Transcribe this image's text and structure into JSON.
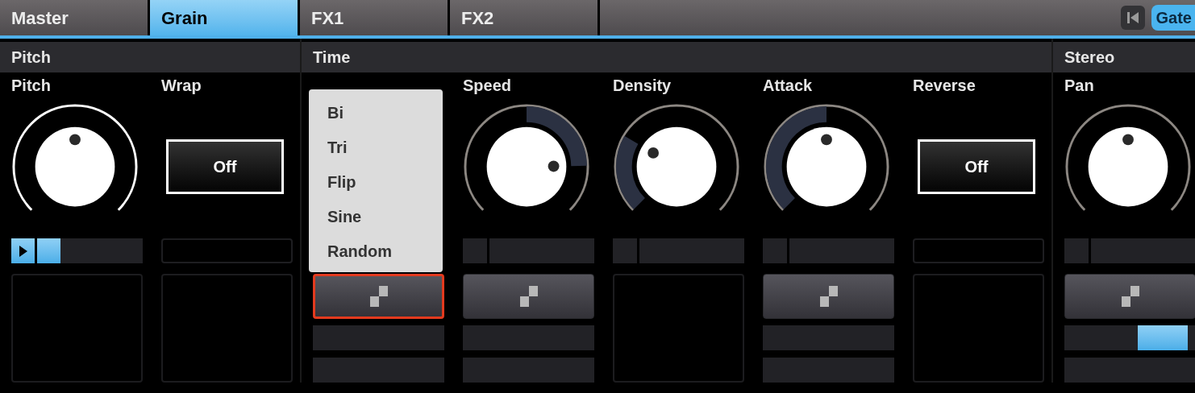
{
  "tabs": [
    {
      "label": "Master",
      "selected": false
    },
    {
      "label": "Grain",
      "selected": true
    },
    {
      "label": "FX1",
      "selected": false
    },
    {
      "label": "FX2",
      "selected": false
    }
  ],
  "gate": {
    "label": "Gate",
    "on": true
  },
  "sections": [
    {
      "title": "Pitch",
      "columns": [
        {
          "label": "Pitch",
          "control": {
            "kind": "knob",
            "highlighted": true
          },
          "slot": {
            "kind": "play",
            "level": 0.22
          },
          "lower": {
            "kind": "empty"
          }
        },
        {
          "label": "Wrap",
          "control": {
            "kind": "toggle",
            "label": "Off",
            "on": false
          },
          "slot": {
            "kind": "outline"
          },
          "lower": {
            "kind": "empty"
          }
        }
      ]
    },
    {
      "title": "Time",
      "columns": [
        {
          "control": {
            "kind": "hidden"
          },
          "slot": {
            "kind": "hidden"
          },
          "lower": {
            "kind": "step",
            "selected": true
          }
        },
        {
          "label": "Speed",
          "control": {
            "kind": "knob",
            "highlighted": false
          },
          "slot": {
            "kind": "split"
          },
          "lower": {
            "kind": "step",
            "selected": false
          }
        },
        {
          "label": "Density",
          "control": {
            "kind": "knob",
            "highlighted": false
          },
          "slot": {
            "kind": "split"
          },
          "lower": {
            "kind": "empty"
          }
        },
        {
          "label": "Attack",
          "control": {
            "kind": "knob",
            "highlighted": false
          },
          "slot": {
            "kind": "split"
          },
          "lower": {
            "kind": "step",
            "selected": false
          }
        },
        {
          "label": "Reverse",
          "control": {
            "kind": "toggle",
            "label": "Off",
            "on": false
          },
          "slot": {
            "kind": "outline"
          },
          "lower": {
            "kind": "empty"
          }
        }
      ]
    },
    {
      "title": "Stereo",
      "columns": [
        {
          "label": "Pan",
          "control": {
            "kind": "knob",
            "highlighted": false
          },
          "slot": {
            "kind": "split"
          },
          "lower": {
            "kind": "step",
            "selected": false,
            "level": 0.75
          }
        }
      ]
    }
  ],
  "menu": {
    "items": [
      "Bi",
      "Tri",
      "Flip",
      "Sine",
      "Random"
    ]
  }
}
